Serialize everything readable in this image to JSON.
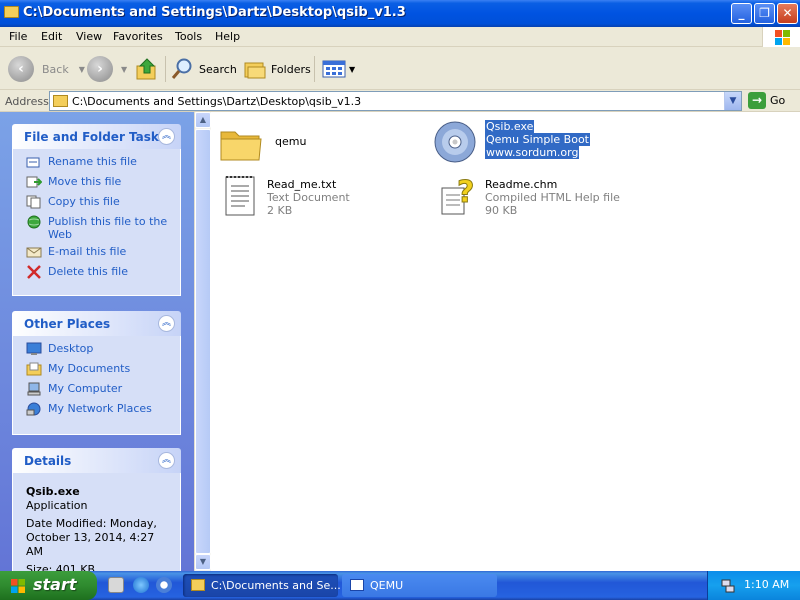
{
  "window": {
    "title": "C:\\Documents and Settings\\Dartz\\Desktop\\qsib_v1.3"
  },
  "menu": [
    "File",
    "Edit",
    "View",
    "Favorites",
    "Tools",
    "Help"
  ],
  "toolbar": {
    "back": "Back",
    "search": "Search",
    "folders": "Folders"
  },
  "address": {
    "label": "Address",
    "value": "C:\\Documents and Settings\\Dartz\\Desktop\\qsib_v1.3",
    "go": "Go"
  },
  "sidebar": {
    "file_tasks": {
      "title": "File and Folder Tasks",
      "items": [
        {
          "label": "Rename this file",
          "icon": "rename-icon"
        },
        {
          "label": "Move this file",
          "icon": "move-icon"
        },
        {
          "label": "Copy this file",
          "icon": "copy-icon"
        },
        {
          "label": "Publish this file to the Web",
          "icon": "publish-web-icon"
        },
        {
          "label": "E-mail this file",
          "icon": "email-icon"
        },
        {
          "label": "Delete this file",
          "icon": "delete-icon"
        }
      ]
    },
    "other_places": {
      "title": "Other Places",
      "items": [
        {
          "label": "Desktop",
          "icon": "desktop-icon"
        },
        {
          "label": "My Documents",
          "icon": "my-documents-icon"
        },
        {
          "label": "My Computer",
          "icon": "my-computer-icon"
        },
        {
          "label": "My Network Places",
          "icon": "network-places-icon"
        }
      ]
    },
    "details": {
      "title": "Details",
      "name": "Qsib.exe",
      "type": "Application",
      "modified": "Date Modified: Monday, October 13, 2014, 4:27 AM",
      "size": "Size: 401 KB"
    }
  },
  "files": [
    {
      "name": "qemu",
      "icon": "folder-icon",
      "lines": []
    },
    {
      "name": "Qsib.exe",
      "icon": "cd-disc-icon",
      "lines": [
        "Qemu Simple Boot",
        "www.sordum.org"
      ],
      "selected": true
    },
    {
      "name": "Read_me.txt",
      "icon": "text-document-icon",
      "lines": [
        "Text Document",
        "2 KB"
      ]
    },
    {
      "name": "Readme.chm",
      "icon": "help-file-icon",
      "lines": [
        "Compiled HTML Help file",
        "90 KB"
      ]
    }
  ],
  "taskbar": {
    "start": "start",
    "tasks": [
      "C:\\Documents and Se...",
      "QEMU"
    ],
    "clock": "1:10 AM"
  },
  "colors": {
    "title_bar": "#0053E1",
    "sidebar_link": "#215DC6",
    "selection": "#316AC5",
    "start_button": "#2F8B2F"
  }
}
